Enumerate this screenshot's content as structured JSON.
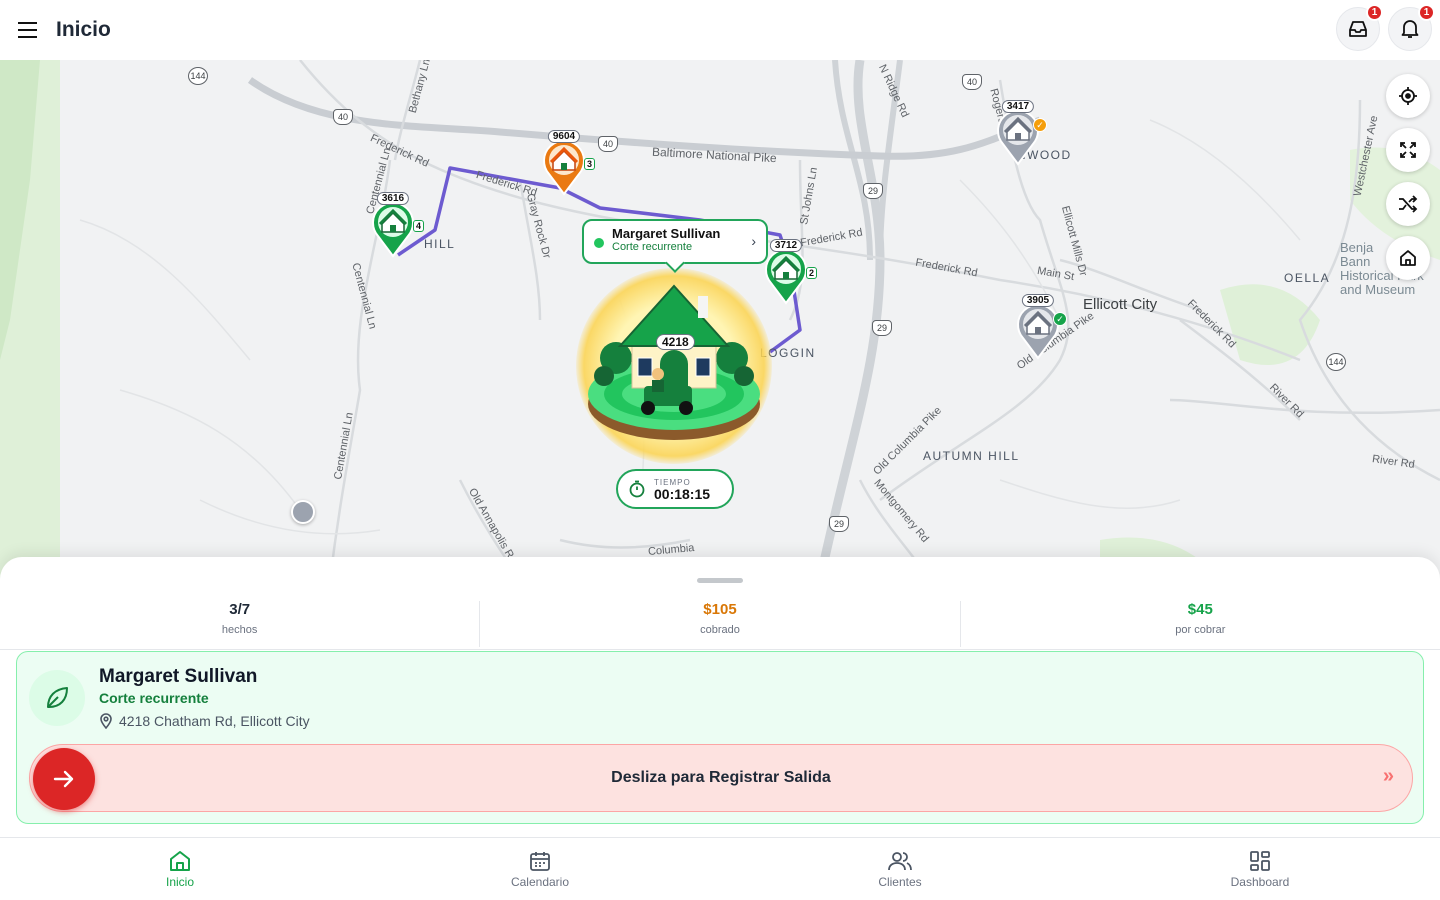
{
  "header": {
    "title": "Inicio",
    "inbox_badge": "1",
    "notif_badge": "1"
  },
  "map": {
    "labels": {
      "frederick_rd_1": "Frederick Rd",
      "frederick_rd_2": "Frederick Rd",
      "frederick_rd_3": "Frederick Rd",
      "frederick_rd_4": "Frederick Rd",
      "frederick_rd_5": "Frederick Rd",
      "baltimore_national_pike": "Baltimore National Pike",
      "bethany_ln": "Bethany Ln",
      "centennial_ln_1": "Centennial Ln",
      "centennial_ln_2": "Centennial Ln",
      "centennial_ln_3": "Centennial Ln",
      "gray_rock_dr": "Gray Rock Dr",
      "st_johns_ln": "St Johns Ln",
      "n_ridge_rd": "N Ridge Rd",
      "rogers": "Rogers",
      "main_st": "Main St",
      "ellicott_mills_dr": "Ellicott Mills Dr",
      "old_columbia_pike_1": "Old Columbia Pike",
      "old_columbia_pike_2": "Old Columbia Pike",
      "westchester_ave": "Westchester Ave",
      "river_rd_1": "River Rd",
      "river_rd_2": "River Rd",
      "old_annapolis_rd": "Old Annapolis Rd",
      "montgomery_rd": "Montgomery Rd",
      "columbia": "Columbia",
      "ellicott_city": "Ellicott City",
      "oella": "OELLA",
      "autumn_hill": "AUTUMN HILL",
      "linwood": "INWOOD",
      "hill": "HILL",
      "loggin": "LOGGIN",
      "museum": "Benja\nBann\nHistorical Park\nand Museum"
    },
    "shields": [
      "144",
      "40",
      "40",
      "40",
      "29",
      "29",
      "29",
      "144"
    ],
    "pins": [
      {
        "num": "9604",
        "count": "3",
        "color": "#ea7a12"
      },
      {
        "num": "3616",
        "count": "4",
        "color": "#16a34a"
      },
      {
        "num": "3712",
        "count": "2",
        "color": "#16a34a"
      },
      {
        "num": "3417",
        "status": "pending",
        "color": "#9ca3af"
      },
      {
        "num": "3905",
        "status": "done",
        "color": "#9ca3af"
      }
    ],
    "callout": {
      "name": "Margaret Sullivan",
      "service": "Corte recurrente"
    },
    "hero_number": "4218",
    "timer": {
      "label": "TIEMPO",
      "value": "00:18:15"
    }
  },
  "stats": [
    {
      "value": "3/7",
      "label": "hechos",
      "color": "#1f2937"
    },
    {
      "value": "$105",
      "label": "cobrado",
      "color": "#d97706"
    },
    {
      "value": "$45",
      "label": "por cobrar",
      "color": "#16a34a"
    }
  ],
  "job": {
    "customer": "Margaret Sullivan",
    "service": "Corte recurrente",
    "address": "4218 Chatham Rd, Ellicott City",
    "slide_label": "Desliza para Registrar Salida"
  },
  "nav": [
    {
      "label": "Inicio",
      "icon": "home-icon",
      "active": true
    },
    {
      "label": "Calendario",
      "icon": "calendar-icon",
      "active": false
    },
    {
      "label": "Clientes",
      "icon": "users-icon",
      "active": false
    },
    {
      "label": "Dashboard",
      "icon": "grid-icon",
      "active": false
    }
  ],
  "colors": {
    "accent": "#16a34a",
    "route": "#6d5bd0",
    "danger": "#dc2626",
    "amount_collected": "#d97706"
  }
}
